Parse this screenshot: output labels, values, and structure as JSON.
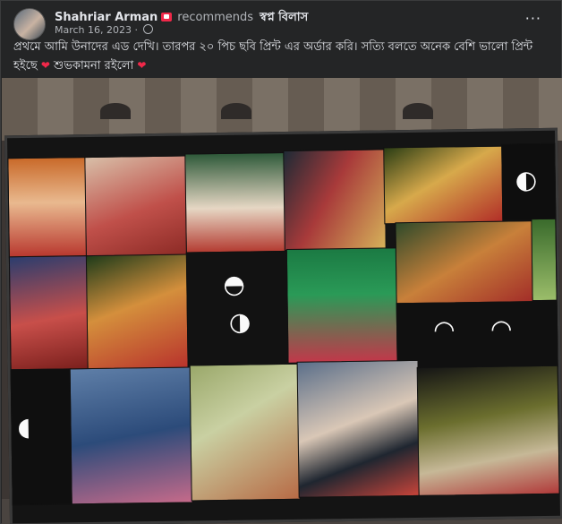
{
  "post": {
    "author": "Shahriar Arman",
    "verb": "recommends",
    "page_name": "স্বপ্ন বিলাস",
    "date": "March 16, 2023",
    "dot": "·",
    "more_label": "···",
    "text": "প্রথমে আমি উনাদের এড দেখি। তারপর ২০ পিচ ছবি প্রিন্ট এর অর্ডার করি। সত্যি বলতে অনেক বেশি ভালো প্রিন্ট হইছে",
    "wish": "শুভকামনা রইলো",
    "heart": "❤"
  },
  "icons": {
    "more": "more-options-icon",
    "privacy": "globe-icon",
    "recommend": "recommend-badge-icon"
  },
  "colors": {
    "background": "#242526",
    "text": "#e4e6eb",
    "muted": "#b0b3b8",
    "heart": "#f02849"
  }
}
